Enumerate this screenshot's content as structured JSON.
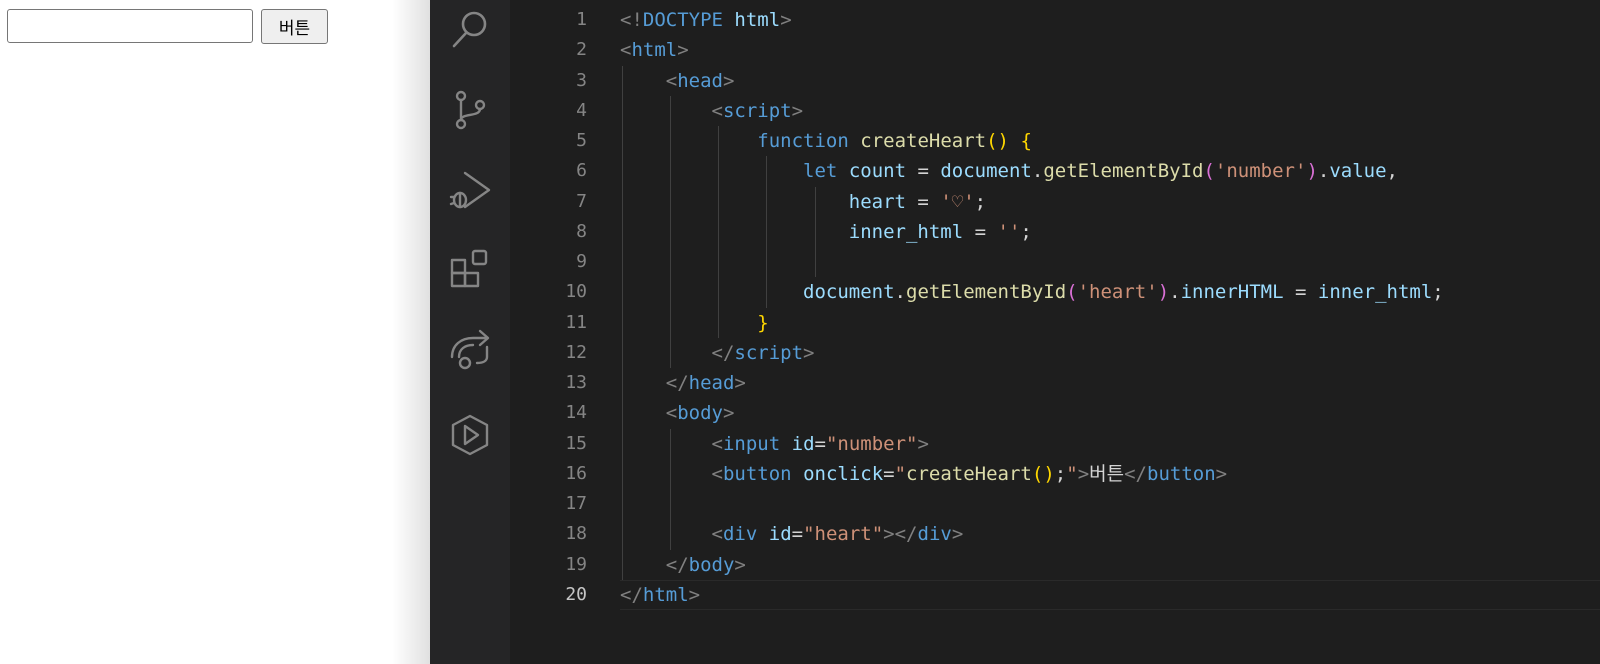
{
  "preview": {
    "input_value": "",
    "button_label": "버튼",
    "heart_output": ""
  },
  "activity_bar": {
    "icons": [
      "search-icon",
      "source-control-icon",
      "run-debug-icon",
      "extensions-icon",
      "live-share-icon",
      "play-icon"
    ]
  },
  "editor": {
    "active_line": 20,
    "line_numbers": [
      "1",
      "2",
      "3",
      "4",
      "5",
      "6",
      "7",
      "8",
      "9",
      "10",
      "11",
      "12",
      "13",
      "14",
      "15",
      "16",
      "17",
      "18",
      "19",
      "20"
    ],
    "lines": [
      [
        [
          "punc",
          "<!"
        ],
        [
          "tag",
          "DOCTYPE"
        ],
        [
          "txt",
          " "
        ],
        [
          "attr",
          "html"
        ],
        [
          "punc",
          ">"
        ]
      ],
      [
        [
          "punc",
          "<"
        ],
        [
          "tag",
          "html"
        ],
        [
          "punc",
          ">"
        ]
      ],
      [
        [
          "txt",
          "    "
        ],
        [
          "punc",
          "<"
        ],
        [
          "tag",
          "head"
        ],
        [
          "punc",
          ">"
        ]
      ],
      [
        [
          "txt",
          "        "
        ],
        [
          "punc",
          "<"
        ],
        [
          "tag",
          "script"
        ],
        [
          "punc",
          ">"
        ]
      ],
      [
        [
          "txt",
          "            "
        ],
        [
          "kw",
          "function"
        ],
        [
          "txt",
          " "
        ],
        [
          "fn",
          "createHeart"
        ],
        [
          "brk1",
          "()"
        ],
        [
          "txt",
          " "
        ],
        [
          "brk1",
          "{"
        ]
      ],
      [
        [
          "txt",
          "                "
        ],
        [
          "kw",
          "let"
        ],
        [
          "txt",
          " "
        ],
        [
          "var",
          "count"
        ],
        [
          "op",
          " = "
        ],
        [
          "var",
          "document"
        ],
        [
          "op",
          "."
        ],
        [
          "fn",
          "getElementById"
        ],
        [
          "brk2",
          "("
        ],
        [
          "str",
          "'number'"
        ],
        [
          "brk2",
          ")"
        ],
        [
          "op",
          "."
        ],
        [
          "var",
          "value"
        ],
        [
          "op",
          ","
        ]
      ],
      [
        [
          "txt",
          "                    "
        ],
        [
          "var",
          "heart"
        ],
        [
          "op",
          " = "
        ],
        [
          "str",
          "'♡'"
        ],
        [
          "op",
          ";"
        ]
      ],
      [
        [
          "txt",
          "                    "
        ],
        [
          "var",
          "inner_html"
        ],
        [
          "op",
          " = "
        ],
        [
          "str",
          "''"
        ],
        [
          "op",
          ";"
        ]
      ],
      [
        [
          "txt",
          ""
        ]
      ],
      [
        [
          "txt",
          "                "
        ],
        [
          "var",
          "document"
        ],
        [
          "op",
          "."
        ],
        [
          "fn",
          "getElementById"
        ],
        [
          "brk2",
          "("
        ],
        [
          "str",
          "'heart'"
        ],
        [
          "brk2",
          ")"
        ],
        [
          "op",
          "."
        ],
        [
          "var",
          "innerHTML"
        ],
        [
          "op",
          " = "
        ],
        [
          "var",
          "inner_html"
        ],
        [
          "op",
          ";"
        ]
      ],
      [
        [
          "txt",
          "            "
        ],
        [
          "brk1",
          "}"
        ]
      ],
      [
        [
          "txt",
          "        "
        ],
        [
          "punc",
          "</"
        ],
        [
          "tag",
          "script"
        ],
        [
          "punc",
          ">"
        ]
      ],
      [
        [
          "txt",
          "    "
        ],
        [
          "punc",
          "</"
        ],
        [
          "tag",
          "head"
        ],
        [
          "punc",
          ">"
        ]
      ],
      [
        [
          "txt",
          "    "
        ],
        [
          "punc",
          "<"
        ],
        [
          "tag",
          "body"
        ],
        [
          "punc",
          ">"
        ]
      ],
      [
        [
          "txt",
          "        "
        ],
        [
          "punc",
          "<"
        ],
        [
          "tag",
          "input"
        ],
        [
          "txt",
          " "
        ],
        [
          "attr",
          "id"
        ],
        [
          "op",
          "="
        ],
        [
          "str",
          "\"number\""
        ],
        [
          "punc",
          ">"
        ]
      ],
      [
        [
          "txt",
          "        "
        ],
        [
          "punc",
          "<"
        ],
        [
          "tag",
          "button"
        ],
        [
          "txt",
          " "
        ],
        [
          "attr",
          "onclick"
        ],
        [
          "op",
          "="
        ],
        [
          "str",
          "\""
        ],
        [
          "fn",
          "createHeart"
        ],
        [
          "brk1",
          "()"
        ],
        [
          "op",
          ";"
        ],
        [
          "str",
          "\""
        ],
        [
          "punc",
          ">"
        ],
        [
          "txt",
          "버튼"
        ],
        [
          "punc",
          "</"
        ],
        [
          "tag",
          "button"
        ],
        [
          "punc",
          ">"
        ]
      ],
      [
        [
          "txt",
          ""
        ]
      ],
      [
        [
          "txt",
          "        "
        ],
        [
          "punc",
          "<"
        ],
        [
          "tag",
          "div"
        ],
        [
          "txt",
          " "
        ],
        [
          "attr",
          "id"
        ],
        [
          "op",
          "="
        ],
        [
          "str",
          "\"heart\""
        ],
        [
          "punc",
          "></"
        ],
        [
          "tag",
          "div"
        ],
        [
          "punc",
          ">"
        ]
      ],
      [
        [
          "txt",
          "    "
        ],
        [
          "punc",
          "</"
        ],
        [
          "tag",
          "body"
        ],
        [
          "punc",
          ">"
        ]
      ],
      [
        [
          "punc",
          "</"
        ],
        [
          "tag",
          "html"
        ],
        [
          "punc",
          ">"
        ]
      ]
    ]
  }
}
